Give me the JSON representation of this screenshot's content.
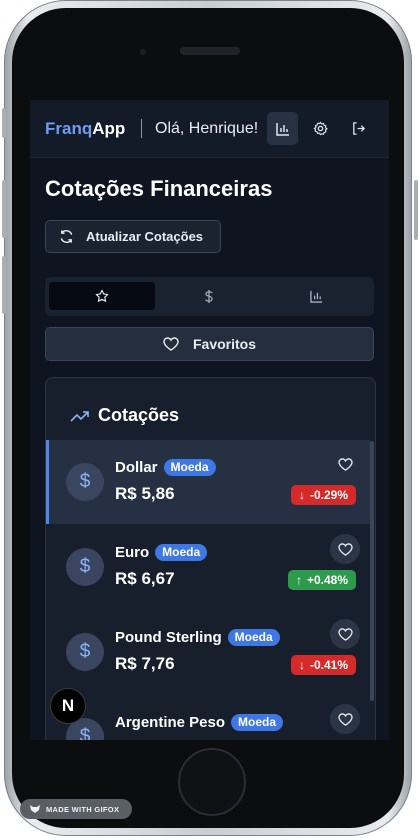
{
  "header": {
    "brand_a": "Franq",
    "brand_b": "App",
    "greeting": "Olá, Henrique!",
    "icons": [
      "bar-chart-icon",
      "gear-icon",
      "logout-icon"
    ]
  },
  "page": {
    "title": "Cotações Financeiras",
    "refresh_label": "Atualizar Cotações",
    "tabs": [
      {
        "icon": "star-icon",
        "active": true
      },
      {
        "icon": "dollar-icon",
        "active": false
      },
      {
        "icon": "bar-chart-icon",
        "active": false
      }
    ],
    "favorites_label": "Favoritos"
  },
  "quotes": {
    "title": "Cotações",
    "items": [
      {
        "name": "Dollar",
        "badge": "Moeda",
        "price": "R$ 5,86",
        "change": "-0.29%",
        "direction": "down",
        "selected": true
      },
      {
        "name": "Euro",
        "badge": "Moeda",
        "price": "R$ 6,67",
        "change": "+0.48%",
        "direction": "up",
        "selected": false
      },
      {
        "name": "Pound Sterling",
        "badge": "Moeda",
        "price": "R$ 7,76",
        "change": "-0.41%",
        "direction": "down",
        "selected": false
      },
      {
        "name": "Argentine Peso",
        "badge": "Moeda",
        "price": "",
        "change": "",
        "direction": "up",
        "selected": false
      }
    ]
  },
  "overlay": {
    "n_label": "N",
    "gifox_label": "MADE WITH GIFOX"
  },
  "colors": {
    "accent": "#4f86ee",
    "down": "#d42a2a",
    "up": "#2e9b4c",
    "background": "#0e1420"
  }
}
